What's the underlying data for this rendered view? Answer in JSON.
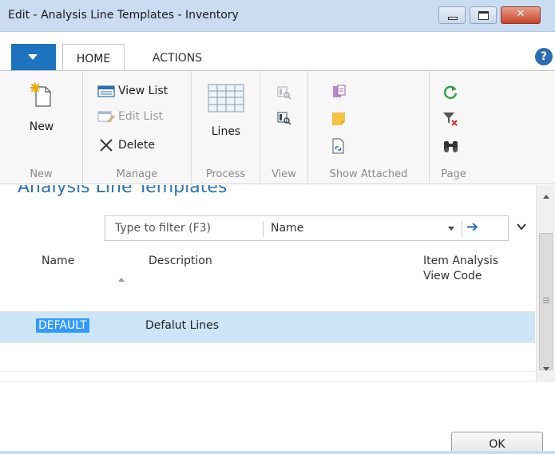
{
  "window": {
    "title": "Edit - Analysis Line Templates - Inventory"
  },
  "ribbon": {
    "tabs": [
      {
        "label": "HOME",
        "selected": true
      },
      {
        "label": "ACTIONS",
        "selected": false
      }
    ],
    "help_label": "?",
    "groups": {
      "new": {
        "label": "New",
        "buttons": {
          "new": "New"
        }
      },
      "manage": {
        "label": "Manage",
        "buttons": {
          "view_list": "View List",
          "edit_list": "Edit List",
          "delete": "Delete"
        }
      },
      "process": {
        "label": "Process",
        "buttons": {
          "lines": "Lines"
        }
      },
      "view": {
        "label": "View"
      },
      "show_attached": {
        "label": "Show Attached"
      },
      "page": {
        "label": "Page"
      }
    }
  },
  "list": {
    "title": "Analysis Line Templates",
    "filter": {
      "placeholder": "Type to filter (F3)",
      "field": "Name"
    },
    "columns": [
      "Name",
      "Description",
      "Item Analysis",
      "View Code"
    ],
    "rows": [
      {
        "name": "DEFAULT",
        "description": "Defalut Lines",
        "item_analysis_view_code": ""
      }
    ]
  },
  "footer": {
    "ok_label": "OK"
  },
  "colors": {
    "accent": "#2b72b5",
    "title_bar": "#c9dcf1",
    "selected_row": "#cde6f7",
    "selection_highlight": "#3399ff"
  }
}
